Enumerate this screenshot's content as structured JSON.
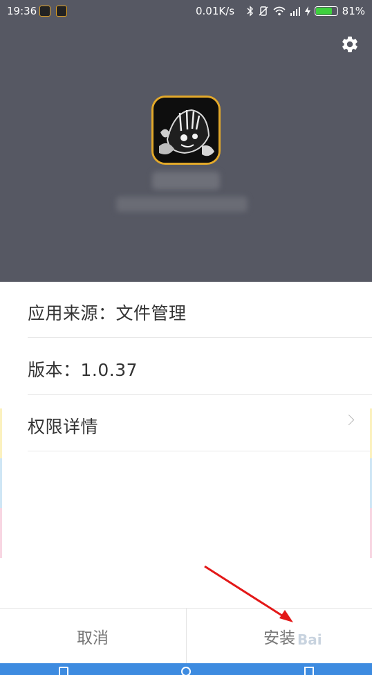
{
  "status_bar": {
    "time": "19:36",
    "net_speed": "0.01K/s",
    "battery_text": "81%",
    "battery_level": 0.81,
    "icons": [
      "bluetooth-icon",
      "vibrate-icon",
      "wifi-icon",
      "signal-icon",
      "charging-icon",
      "battery-icon"
    ]
  },
  "header": {
    "settings_icon": "gear-icon",
    "background_color": "#565863",
    "icon_border_color": "#e3a92a"
  },
  "details": [
    {
      "label": "应用来源：文件管理"
    },
    {
      "label": "版本：1.0.37"
    },
    {
      "label": "权限详情",
      "icon": "chevron-right-icon"
    }
  ],
  "actions": {
    "cancel": "取消",
    "install": "安装"
  },
  "annotation": {
    "arrow_color": "#e31818"
  },
  "nav_bar": {
    "color": "#3d8be0"
  },
  "watermark": "Bai"
}
